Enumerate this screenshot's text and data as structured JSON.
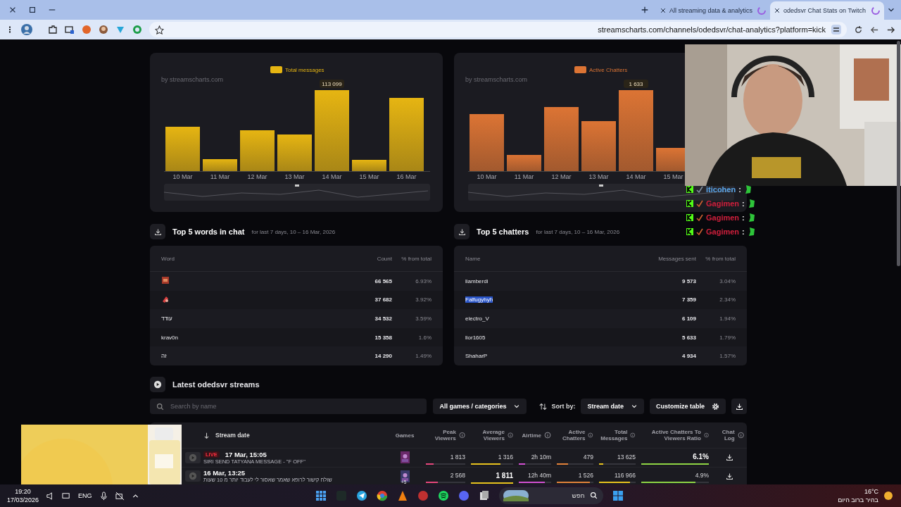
{
  "browser": {
    "tabs": [
      {
        "title": "All streaming data & analytics",
        "selected": false
      },
      {
        "title": "odedsvr Chat Stats on Twitch",
        "selected": true
      }
    ],
    "url": "streamscharts.com/channels/odedsvr/chat-analytics?platform=kick"
  },
  "charts": [
    {
      "legend": "Total messages",
      "color": "#e6b512",
      "watermark": "by streamscharts.com",
      "peak_label": "113 099",
      "categories": [
        "10 Mar",
        "11 Mar",
        "12 Mar",
        "13 Mar",
        "14 Mar",
        "15 Mar",
        "16 Mar"
      ]
    },
    {
      "legend": "Active Chatters",
      "color": "#dc7434",
      "watermark": "by streamscharts.com",
      "peak_label": "1 633",
      "categories": [
        "10 Mar",
        "11 Mar",
        "12 Mar",
        "13 Mar",
        "14 Mar",
        "15 Mar"
      ]
    }
  ],
  "top_words": {
    "title": "Top 5 words in chat",
    "subtitle": "for last 7 days, 10 – 16 Mar, 2026",
    "columns": [
      "Word",
      "Count",
      "% from total"
    ],
    "rows": [
      {
        "kind": "emote",
        "count": "66 565",
        "share": "6.93%"
      },
      {
        "kind": "emote",
        "count": "37 682",
        "share": "3.92%"
      },
      {
        "kind": "text",
        "word": "עודד",
        "count": "34 532",
        "share": "3.59%"
      },
      {
        "kind": "text",
        "word": "krav0n",
        "count": "15 358",
        "share": "1.6%"
      },
      {
        "kind": "text",
        "word": "זה",
        "count": "14 290",
        "share": "1.49%"
      }
    ]
  },
  "top_chatters": {
    "title": "Top 5 chatters",
    "subtitle": "for last 7 days, 10 – 16 Mar, 2026",
    "columns": [
      "Name",
      "Messages sent",
      "% from total"
    ],
    "rows": [
      {
        "name": "liamberdi",
        "count": "9 573",
        "share": "3.04%",
        "highlighted": false
      },
      {
        "name": "Falfugyhyh",
        "count": "7 359",
        "share": "2.34%",
        "highlighted": true
      },
      {
        "name": "electro_V",
        "count": "6 109",
        "share": "1.94%",
        "highlighted": false
      },
      {
        "name": "lior1605",
        "count": "5 633",
        "share": "1.79%",
        "highlighted": false
      },
      {
        "name": "ShaharP",
        "count": "4 934",
        "share": "1.57%",
        "highlighted": false
      }
    ]
  },
  "streams": {
    "title": "Latest odedsvr streams",
    "search_placeholder": "Search by name",
    "filter": "All games / categories",
    "sort_label": "Sort by:",
    "sort_value": "Stream date",
    "customize": "Customize table",
    "date_column": "Stream date",
    "games_column": "Games",
    "chat_log_column": "Chat Log",
    "metric_columns": [
      {
        "label": "Peak Viewers",
        "color": "#e5467c"
      },
      {
        "label": "Average Viewers",
        "color": "#e8c21e"
      },
      {
        "label": "Airtime",
        "color": "#d24fd2"
      },
      {
        "label": "Active Chatters",
        "color": "#e2823a"
      },
      {
        "label": "Total Messages",
        "color": "#e8c21e"
      },
      {
        "label": "Active Chatters To Viewers Ratio",
        "color": "#8fd444"
      }
    ],
    "rows": [
      {
        "live": true,
        "live_label": "LIVE",
        "date": "17 Mar, 15:05",
        "title": "SIRI SEND TATYANA MESSAGE - \"F OFF\"",
        "metrics": [
          {
            "value": "1 813",
            "level": 0.2,
            "best": false
          },
          {
            "value": "1 316",
            "level": 0.7,
            "best": false
          },
          {
            "value": "2h 10m",
            "level": 0.2,
            "best": false
          },
          {
            "value": "479",
            "level": 0.3,
            "best": false
          },
          {
            "value": "13 625",
            "level": 0.12,
            "best": false
          },
          {
            "value": "6.1%",
            "level": 1,
            "best": true
          }
        ]
      },
      {
        "live": false,
        "date": "16 Mar, 13:25",
        "title": "שולח קישור לרופא שאמר שאסור לי לעבוד יותר מ 10 שעות",
        "extra_games": "+5",
        "metrics": [
          {
            "value": "2 568",
            "level": 0.3,
            "best": false
          },
          {
            "value": "1 811",
            "level": 1,
            "best": true
          },
          {
            "value": "12h 40m",
            "level": 0.8,
            "best": false
          },
          {
            "value": "1 526",
            "level": 0.9,
            "best": false
          },
          {
            "value": "116 966",
            "level": 0.85,
            "best": false
          },
          {
            "value": "4.9%",
            "level": 0.8,
            "best": false
          }
        ]
      }
    ]
  },
  "chat_overlay": [
    {
      "name": "iticohen",
      "color": "#5aa6ea",
      "separator": ":"
    },
    {
      "name": "Gagimen",
      "color": "#d11f3c",
      "separator": ":"
    },
    {
      "name": "Gagimen",
      "color": "#d11f3c",
      "separator": ":"
    },
    {
      "name": "Gagimen",
      "color": "#d11f3c",
      "separator": ":"
    }
  ],
  "taskbar": {
    "time": "19:20",
    "date": "17/03/2026",
    "language": "ENG",
    "search_placeholder": "חפש",
    "temperature": "16°C",
    "weather": "בהיר ברוב היום"
  }
}
